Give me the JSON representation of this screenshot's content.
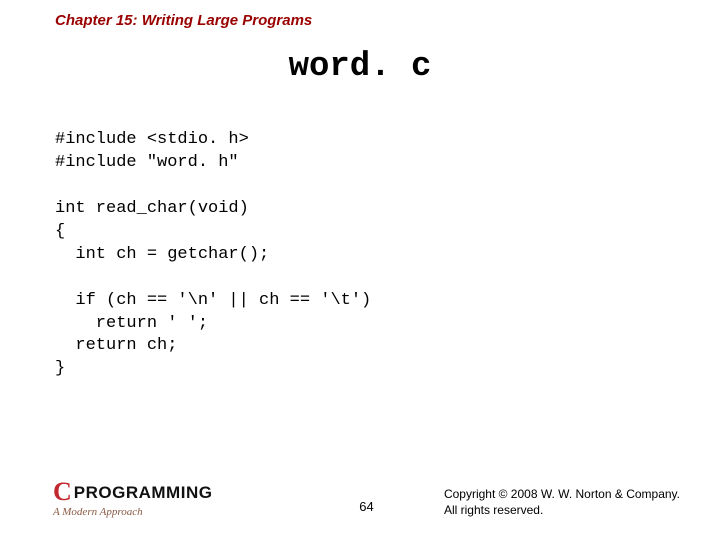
{
  "chapter": "Chapter 15: Writing Large Programs",
  "title": "word. c",
  "code": "#include <stdio. h>\n#include \"word. h\"\n\nint read_char(void)\n{\n  int ch = getchar();\n\n  if (ch == '\\n' || ch == '\\t')\n    return ' ';\n  return ch;\n}",
  "logo": {
    "c": "C",
    "text": "PROGRAMMING",
    "subtitle": "A Modern Approach"
  },
  "page_number": "64",
  "copyright_line1": "Copyright © 2008 W. W. Norton & Company.",
  "copyright_line2": "All rights reserved."
}
